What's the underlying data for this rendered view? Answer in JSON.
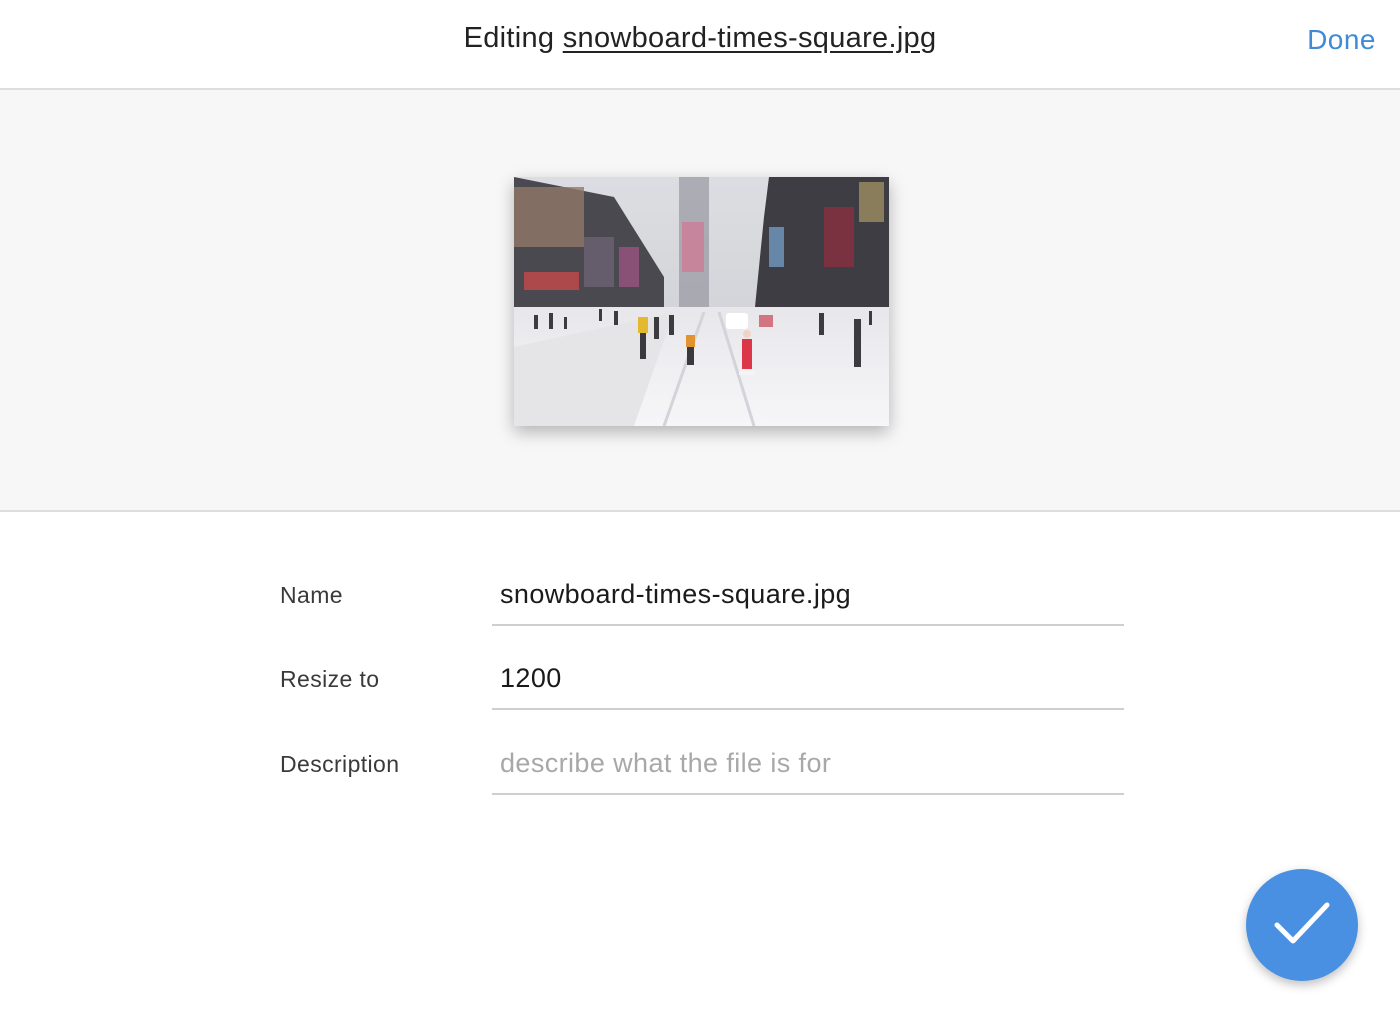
{
  "header": {
    "title_prefix": "Editing",
    "filename": "snowboard-times-square.jpg",
    "done_label": "Done"
  },
  "preview": {
    "alt": "snowboard-times-square.jpg"
  },
  "form": {
    "name": {
      "label": "Name",
      "value": "snowboard-times-square.jpg"
    },
    "resize": {
      "label": "Resize to",
      "value": "1200"
    },
    "description": {
      "label": "Description",
      "value": "",
      "placeholder": "describe what the file is for"
    }
  },
  "fab": {
    "icon": "checkmark-icon"
  },
  "colors": {
    "accent": "#4a90e2",
    "link": "#3f8bd6",
    "divider": "#dedede",
    "preview_bg": "#f7f7f7"
  }
}
